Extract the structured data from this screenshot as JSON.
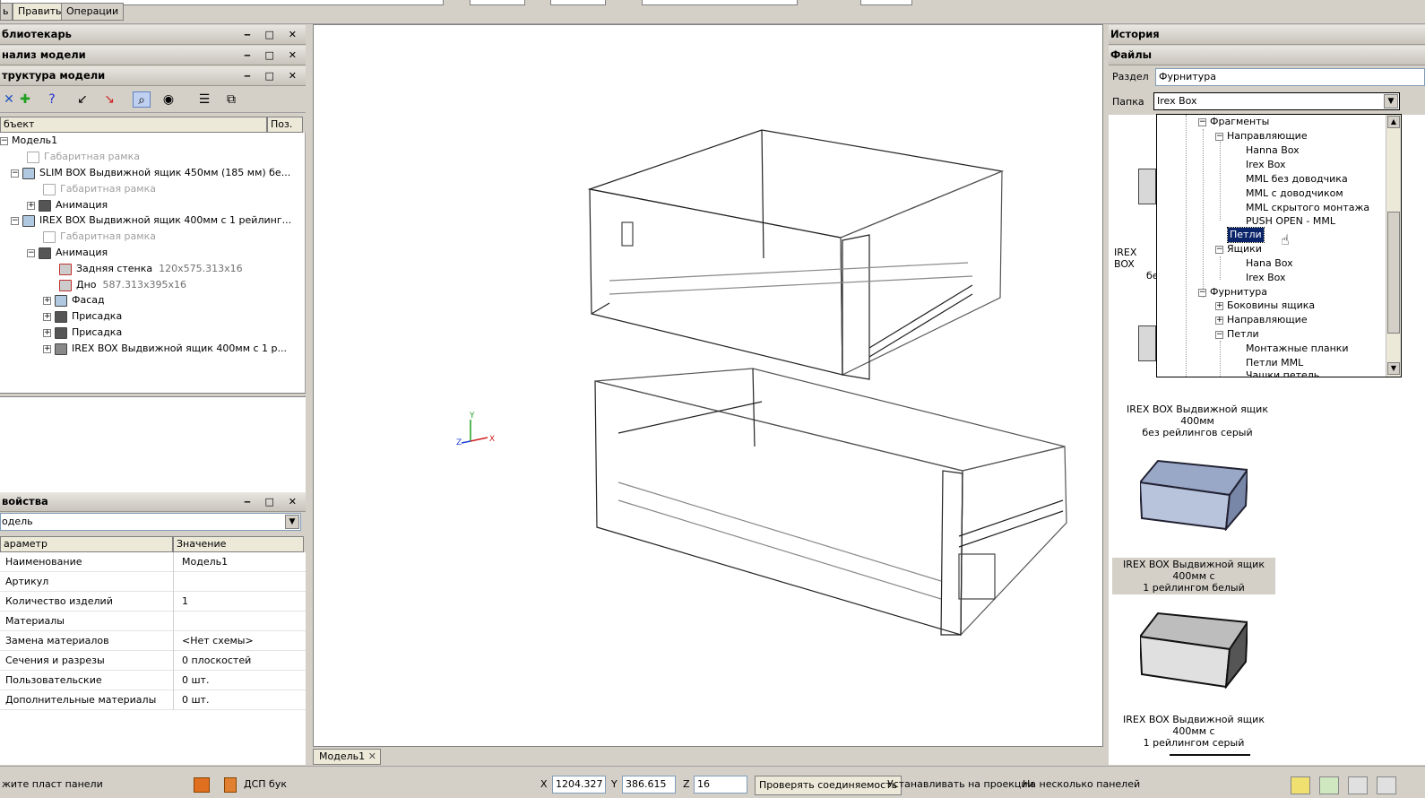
{
  "menu": {
    "tab1": "ь",
    "tab2": "Править",
    "tab3": "Операции"
  },
  "left": {
    "library_title": "блиотекарь",
    "analysis_title": "нализ модели",
    "structure_title": "труктура модели",
    "panel_controls": "‒ □ ✕",
    "tree_col_object": "бъект",
    "tree_col_pos": "Поз.",
    "tree": [
      {
        "label": "Модель1",
        "dim": ""
      },
      {
        "label": "Габаритная рамка",
        "dim": ""
      },
      {
        "label": "SLIM BOX Выдвижной ящик 450мм (185 мм)  бе...",
        "dim": ""
      },
      {
        "label": "Габаритная рамка",
        "dim": ""
      },
      {
        "label": "Анимация",
        "dim": ""
      },
      {
        "label": "IREX BOX Выдвижной ящик 400мм с 1 рейлинг...",
        "dim": ""
      },
      {
        "label": "Габаритная рамка",
        "dim": ""
      },
      {
        "label": "Анимация",
        "dim": ""
      },
      {
        "label": "Задняя стенка",
        "dim": "120x575.313x16"
      },
      {
        "label": "Дно",
        "dim": "587.313x395x16"
      },
      {
        "label": "Фасад",
        "dim": ""
      },
      {
        "label": "Присадка",
        "dim": ""
      },
      {
        "label": "Присадка",
        "dim": ""
      },
      {
        "label": "IREX BOX Выдвижной ящик 400мм с 1 р...",
        "dim": ""
      }
    ],
    "props_title": "войства",
    "props_select": "одель",
    "props_col_param": "араметр",
    "props_col_value": "Значение",
    "props": [
      {
        "k": "Наименование",
        "v": "Модель1"
      },
      {
        "k": "Артикул",
        "v": ""
      },
      {
        "k": "Количество изделий",
        "v": "1"
      },
      {
        "k": "Материалы",
        "v": ""
      },
      {
        "k": "Замена материалов",
        "v": "<Нет схемы>"
      },
      {
        "k": "Сечения и разрезы",
        "v": "0 плоскостей"
      },
      {
        "k": "Пользовательские",
        "v": "0 шт."
      },
      {
        "k": "Дополнительные материалы",
        "v": "0 шт."
      }
    ]
  },
  "viewport": {
    "tab": "Модель1",
    "tab_close": "✕",
    "axis_y": "Y",
    "axis_x": "X",
    "axis_z": "Z"
  },
  "right": {
    "history_title": "История",
    "files_title": "Файлы",
    "section_label": "Раздел",
    "section_value": "Фурнитура",
    "folder_label": "Папка",
    "folder_value": "Irex Box",
    "dropdown": [
      {
        "label": "Фрагменты"
      },
      {
        "label": "Направляющие"
      },
      {
        "label": "Hanna Box"
      },
      {
        "label": "Irex Box"
      },
      {
        "label": "MML без доводчика"
      },
      {
        "label": "MML с доводчиком"
      },
      {
        "label": "MML скрытого монтажа"
      },
      {
        "label": "PUSH OPEN - MML"
      },
      {
        "label": "Петли"
      },
      {
        "label": "Ящики"
      },
      {
        "label": "Hana Box"
      },
      {
        "label": "Irex Box"
      },
      {
        "label": "Фурнитура"
      },
      {
        "label": "Боковины ящика"
      },
      {
        "label": "Направляющие"
      },
      {
        "label": "Петли"
      },
      {
        "label": "Монтажные планки"
      },
      {
        "label": "Петли MML"
      },
      {
        "label": "Чашки петель"
      }
    ],
    "captions": [
      {
        "l1": "IREX BOX",
        "l2": "бе"
      },
      {
        "l1": "IREX BOX Выдвижной ящик 400мм",
        "l2": "без рейлингов серый"
      },
      {
        "l1": "IREX BOX Выдвижной ящик 400мм с",
        "l2": "1 рейлингом белый"
      },
      {
        "l1": "IREX BOX Выдвижной ящик 400мм с",
        "l2": "1 рейлингом серый"
      }
    ]
  },
  "status": {
    "hint": "жите пласт панели",
    "material": "ДСП бук",
    "x_label": "X",
    "x_value": "1204.327",
    "y_label": "Y",
    "y_value": "386.615",
    "z_label": "Z",
    "z_value": "16",
    "check_button": "Проверять соединяемость",
    "projections": "Устанавливать на проекции",
    "multiple_panels": "На несколько панелей"
  }
}
